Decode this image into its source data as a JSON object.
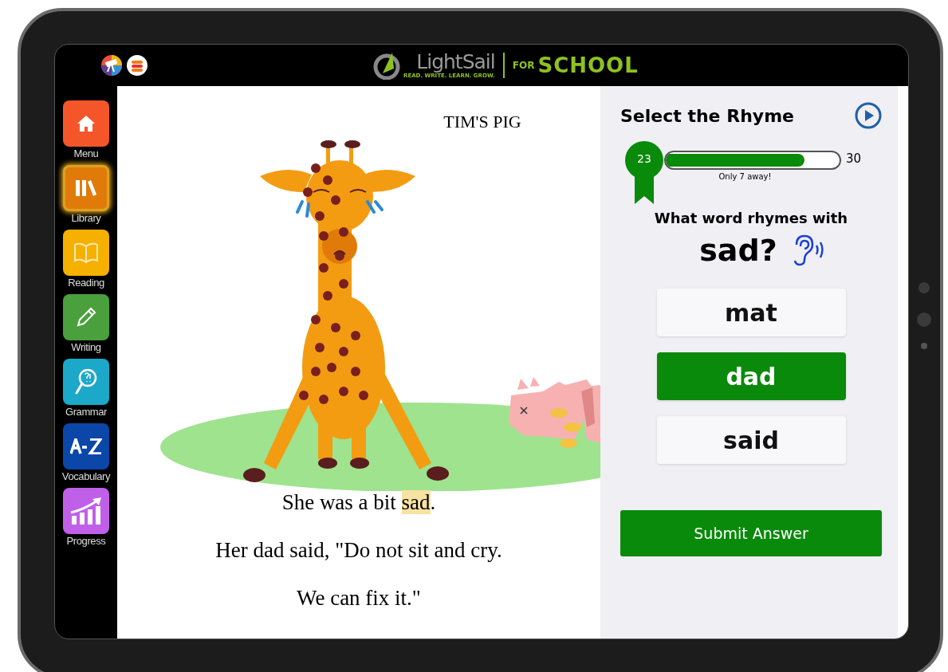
{
  "top_bar": {
    "logo": {
      "brand": "LightSail",
      "tagline": "READ. WRITE. LEARN. GROW.",
      "for": "FOR",
      "product": "SCHOOL"
    }
  },
  "sidebar": {
    "items": [
      {
        "label": "Menu",
        "kind": "home",
        "color": "#f4562a",
        "selected": false
      },
      {
        "label": "Library",
        "kind": "library",
        "color": "#e07b0a",
        "selected": true
      },
      {
        "label": "Reading",
        "kind": "reading",
        "color": "#f5b000",
        "selected": false
      },
      {
        "label": "Writing",
        "kind": "writing",
        "color": "#4aa03c",
        "selected": false
      },
      {
        "label": "Grammar",
        "kind": "grammar",
        "color": "#1ba8c9",
        "selected": false
      },
      {
        "label": "Vocabulary",
        "kind": "vocabulary",
        "color": "#0a47a8",
        "selected": false
      },
      {
        "label": "Progress",
        "kind": "progress",
        "color": "#c060e8",
        "selected": false
      }
    ]
  },
  "book": {
    "title": "TIM'S PIG",
    "lines": [
      {
        "before": "She was a bit ",
        "highlight": "sad",
        "after": "."
      },
      {
        "before": "Her dad said, \"Do not sit and cry."
      },
      {
        "before": "We can fix it.\""
      }
    ]
  },
  "quiz": {
    "title": "Select the Rhyme",
    "progress": {
      "current": "23",
      "goal": "30",
      "level": 0.8,
      "note": "Only 7 away!"
    },
    "question": "What word rhymes with",
    "target_word": "sad?",
    "choices": [
      {
        "label": "mat",
        "selected": false
      },
      {
        "label": "dad",
        "selected": true
      },
      {
        "label": "said",
        "selected": false
      }
    ],
    "submit": "Submit Answer"
  }
}
